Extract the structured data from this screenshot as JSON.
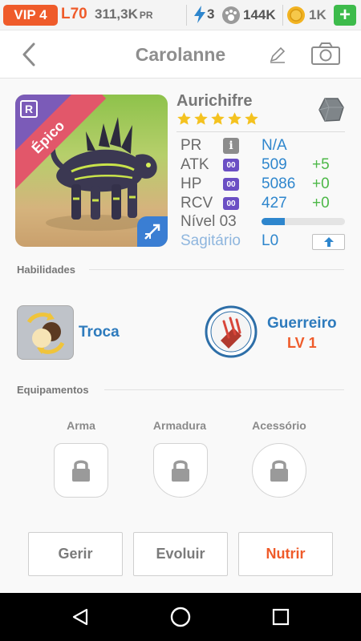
{
  "status": {
    "vip": "VIP 4",
    "level": "L70",
    "power_value": "311,3K",
    "power_unit": "PR",
    "energy": "3",
    "paw_count": "144K",
    "coins": "1K",
    "add_label": "+"
  },
  "header": {
    "title": "Carolanne"
  },
  "monster": {
    "rarity_tag": "R",
    "rarity": "Épico",
    "name": "Aurichifre",
    "stars": 5,
    "stats": [
      {
        "label": "PR",
        "value": "N/A",
        "inc": ""
      },
      {
        "label": "ATK",
        "badge": "00",
        "value": "509",
        "inc": "+5"
      },
      {
        "label": "HP",
        "badge": "00",
        "value": "5086",
        "inc": "+0"
      },
      {
        "label": "RCV",
        "badge": "00",
        "value": "427",
        "inc": "+0"
      }
    ],
    "level_label": "Nível 03",
    "level_progress": 0.28,
    "sign_label": "Sagitário",
    "sign_level": "L0"
  },
  "abilities": {
    "section_label": "Habilidades",
    "skill_name": "Troca",
    "class_name": "Guerreiro",
    "class_level": "LV 1"
  },
  "equipment": {
    "section_label": "Equipamentos",
    "slots": [
      "Arma",
      "Armadura",
      "Acessório"
    ]
  },
  "actions": {
    "manage": "Gerir",
    "evolve": "Evoluir",
    "feed": "Nutrir"
  },
  "colors": {
    "accent_orange": "#ef5b2a",
    "accent_blue": "#2e86cd",
    "positive_green": "#4db848",
    "badge_purple": "#6b4fc4",
    "rarity_pink": "#e2576a"
  }
}
